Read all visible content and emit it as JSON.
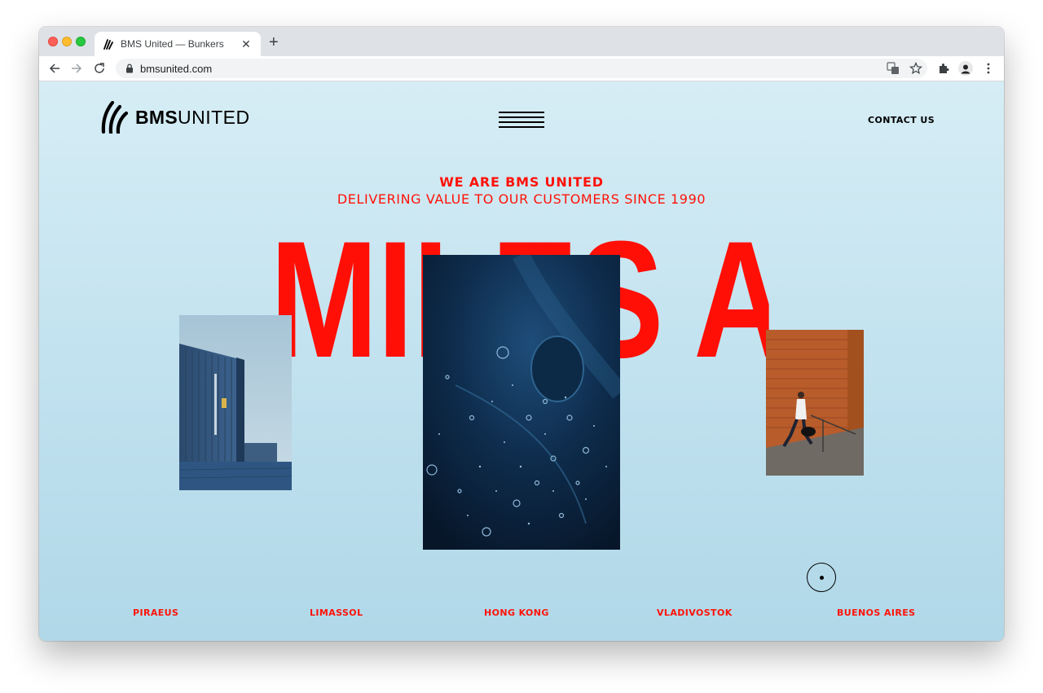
{
  "browser": {
    "tab_title": "BMS United — Bunkers",
    "close_glyph": "✕",
    "new_tab_glyph": "+",
    "url": "bmsunited.com"
  },
  "site": {
    "logo_bold": "BMS",
    "logo_light": "UNITED",
    "contact_label": "CONTACT US",
    "eyebrow": "WE ARE BMS UNITED",
    "subline": "DELIVERING VALUE TO OUR CUSTOMERS SINCE 1990",
    "headline": "MILES AHEAD",
    "cities": [
      "PIRAEUS",
      "LIMASSOL",
      "HONG KONG",
      "VLADIVOSTOK",
      "BUENOS AIRES"
    ]
  },
  "colors": {
    "accent_red": "#ff1208",
    "page_bg_top": "#d6edf5",
    "page_bg_bottom": "#b0d8e8"
  },
  "icons": [
    "back-icon",
    "forward-icon",
    "reload-icon",
    "lock-icon",
    "translate-icon",
    "star-icon",
    "extensions-icon",
    "profile-avatar",
    "kebab-menu-icon",
    "hamburger-menu-icon"
  ]
}
